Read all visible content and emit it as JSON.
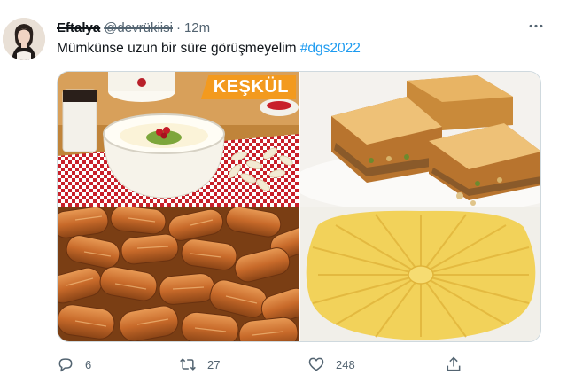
{
  "user": {
    "display_name": "Eftalya",
    "handle": "@devrükiisi",
    "separator": "·",
    "time": "12m"
  },
  "tweet": {
    "text": "Mümkünse uzun bir süre görüşmeyelim ",
    "hashtag": "#dgs2022"
  },
  "media": {
    "image1_label": "KEŞKÜL"
  },
  "actions": {
    "replies": "6",
    "retweets": "27",
    "likes": "248"
  },
  "colors": {
    "hashtag": "#1d9bf0",
    "muted": "#536471",
    "label_bg": "#f39a1e"
  },
  "icons": [
    "more-icon",
    "reply-icon",
    "retweet-icon",
    "like-icon",
    "share-icon"
  ]
}
